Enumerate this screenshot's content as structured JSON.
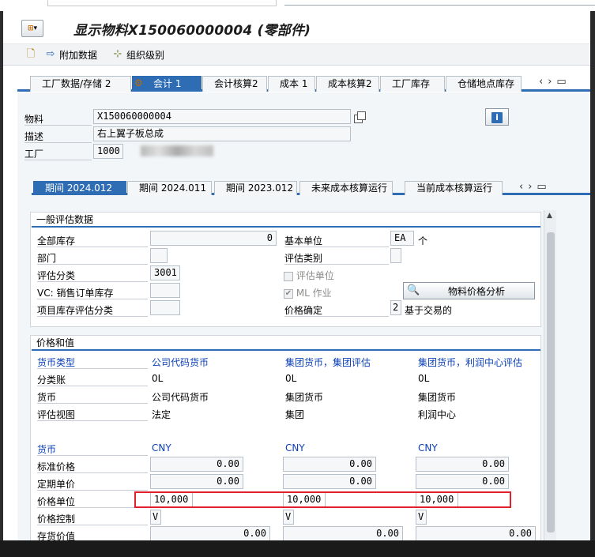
{
  "window": {
    "title": "显示物料X150060000004 (零部件)"
  },
  "toolbar": {
    "btn_additional": "附加数据",
    "btn_org_levels": "组织级别"
  },
  "tabs": [
    {
      "label": "工厂数据/存储 2"
    },
    {
      "label": "会计 1"
    },
    {
      "label": "会计核算2"
    },
    {
      "label": "成本 1"
    },
    {
      "label": "成本核算2"
    },
    {
      "label": "工厂库存"
    },
    {
      "label": "仓储地点库存"
    }
  ],
  "header": {
    "material_label": "物料",
    "material_value": "X150060000004",
    "desc_label": "描述",
    "desc_value": "右上翼子板总成",
    "plant_label": "工厂",
    "plant_value": "1000"
  },
  "period_tabs": [
    {
      "label": "期间 2024.012"
    },
    {
      "label": "期间 2024.011"
    },
    {
      "label": "期间 2023.012"
    },
    {
      "label": "未来成本核算运行"
    },
    {
      "label": "当前成本核算运行"
    }
  ],
  "general": {
    "section_title": "一般评估数据",
    "total_stock_label": "全部库存",
    "total_stock_value": "0",
    "base_unit_label": "基本单位",
    "base_unit_value": "EA",
    "base_unit_text": "个",
    "division_label": "部门",
    "division_value": "",
    "valuation_category_label": "评估类别",
    "valuation_category_value": "",
    "valuation_class_label": "评估分类",
    "valuation_class_value": "3001",
    "valuated_unit_label": "评估单位",
    "vc_sales_label": "VC: 销售订单库存",
    "ml_label": "ML 作业",
    "project_stock_label": "项目库存评估分类",
    "price_determination_label": "价格确定",
    "price_determination_value": "2",
    "price_determination_text": "基于交易的",
    "analysis_button": "物料价格分析"
  },
  "prices": {
    "section_title": "价格和值",
    "currency_type_label": "货币类型",
    "col1_header": "公司代码货币",
    "col2_header": "集团货币，集团评估",
    "col3_header": "集团货币，利润中心评估",
    "ledger_label": "分类账",
    "ledger": [
      "0L",
      "0L",
      "0L"
    ],
    "currency_label": "货币",
    "currency_names": [
      "公司代码货币",
      "集团货币",
      "集团货币"
    ],
    "valuation_view_label": "评估视图",
    "valuation_views": [
      "法定",
      "集团",
      "利润中心"
    ],
    "currency2_label": "货币",
    "currencies": [
      "CNY",
      "CNY",
      "CNY"
    ],
    "std_price_label": "标准价格",
    "std_prices": [
      "0.00",
      "0.00",
      "0.00"
    ],
    "periodic_price_label": "定期单价",
    "periodic_prices": [
      "0.00",
      "0.00",
      "0.00"
    ],
    "price_unit_label": "价格单位",
    "price_units": [
      "10,000",
      "10,000",
      "10,000"
    ],
    "price_control_label": "价格控制",
    "price_controls": [
      "V",
      "V",
      "V"
    ],
    "inventory_value_label": "存货价值",
    "inventory_values": [
      "0.00",
      "0.00",
      "0.00"
    ]
  },
  "colors": {
    "accent": "#2e6cb3",
    "highlight_border": "#e0202a",
    "link": "#0a3fb7"
  }
}
